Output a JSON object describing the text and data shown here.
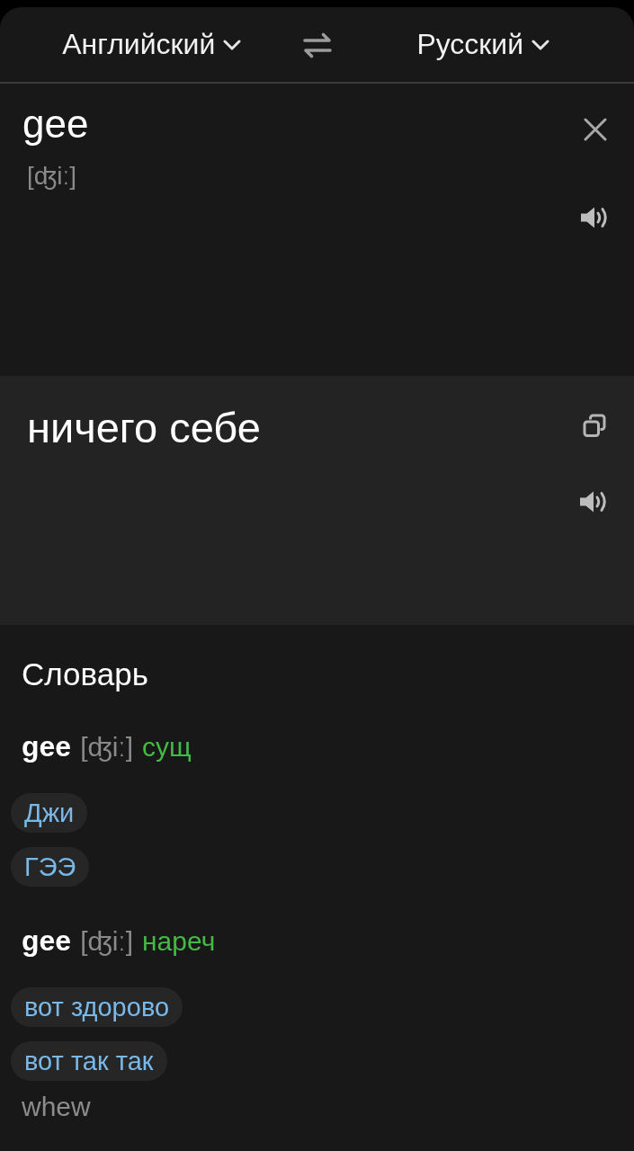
{
  "header": {
    "source_language": "Английский",
    "target_language": "Русский"
  },
  "input": {
    "value": "gee",
    "transcription": "[ʤiː]"
  },
  "output": {
    "text": "ничего себе"
  },
  "dictionary": {
    "title": "Словарь",
    "entries": [
      {
        "word": "gee",
        "transcription": "[ʤiː]",
        "part_of_speech": "сущ",
        "translations": [
          "Джи",
          "ГЭЭ"
        ]
      },
      {
        "word": "gee",
        "transcription": "[ʤiː]",
        "part_of_speech": "нареч",
        "translations": [
          "вот здорово",
          "вот так так"
        ],
        "meanings": [
          "whew"
        ]
      }
    ]
  }
}
